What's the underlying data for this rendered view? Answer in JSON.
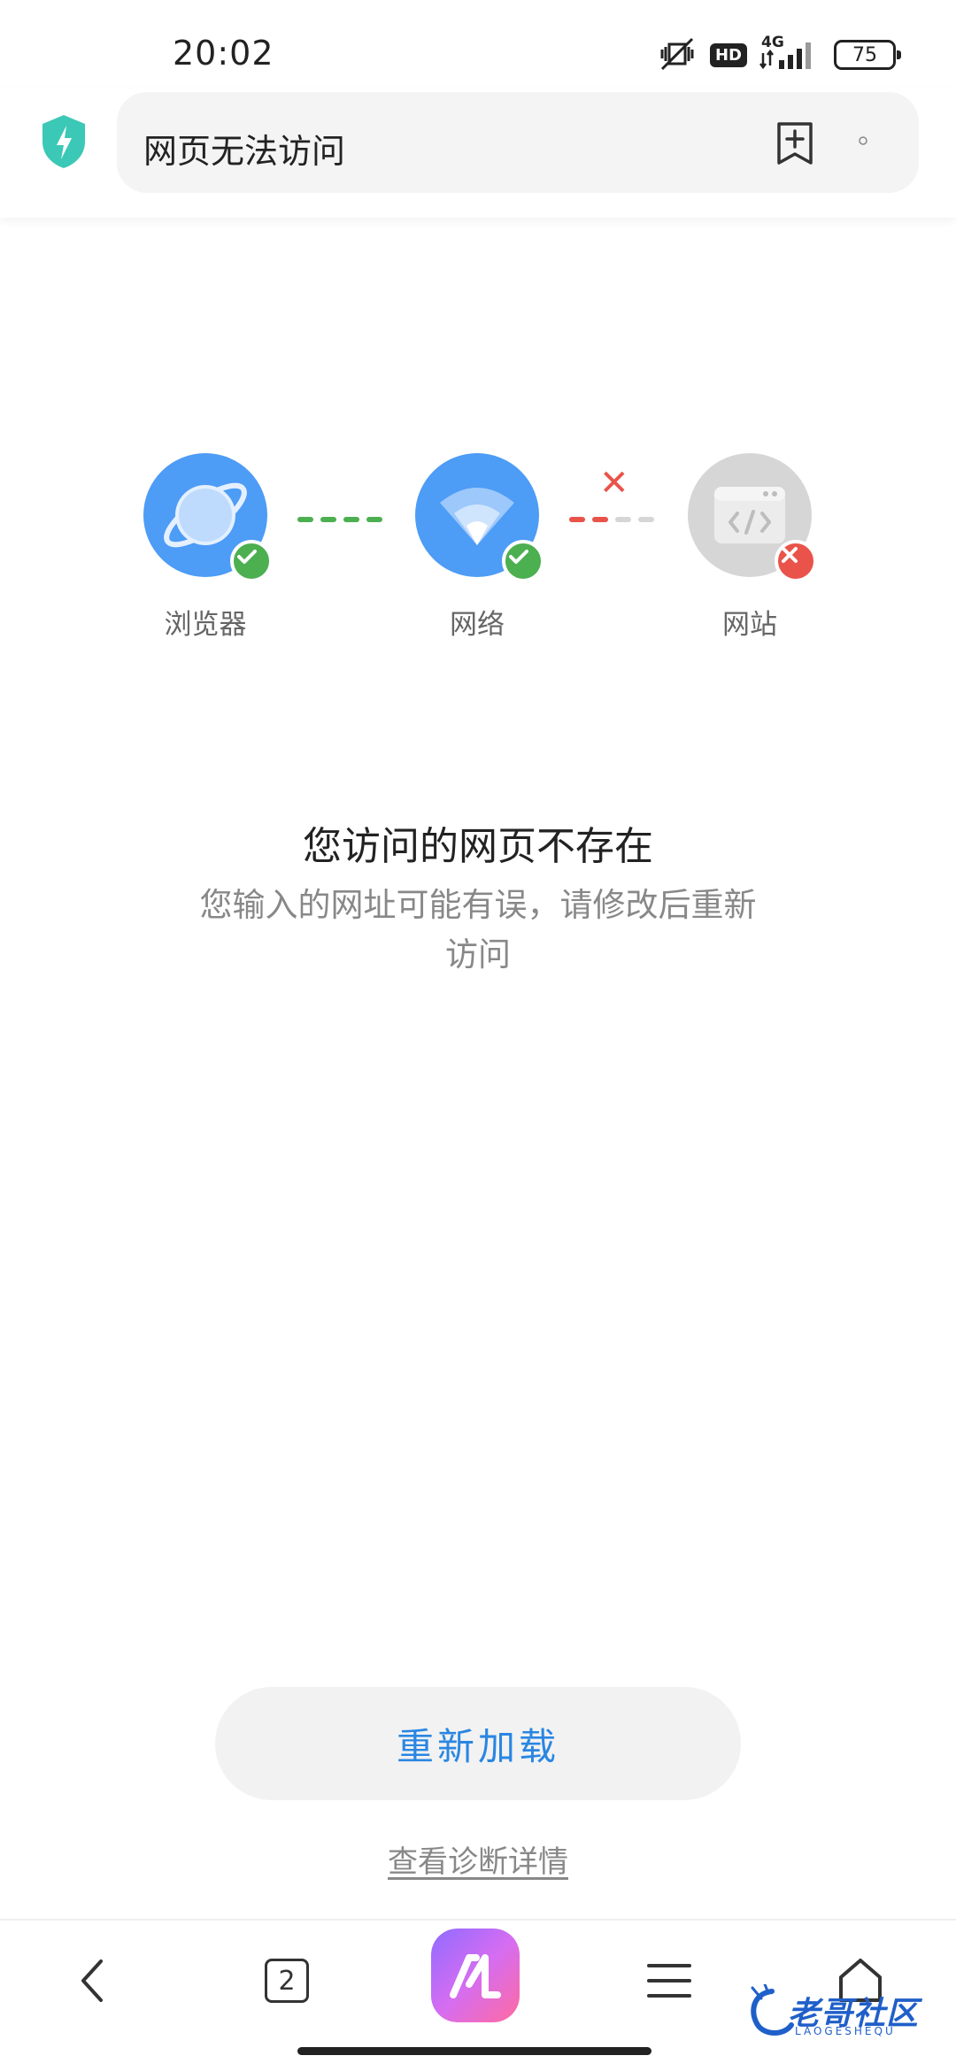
{
  "status_bar": {
    "time": "20:02",
    "hd": "HD",
    "network_type": "4G",
    "battery": "75"
  },
  "address_bar": {
    "title": "网页无法访问"
  },
  "diagnosis": {
    "nodes": [
      {
        "label": "浏览器",
        "status": "ok"
      },
      {
        "label": "网络",
        "status": "ok"
      },
      {
        "label": "网站",
        "status": "error"
      }
    ]
  },
  "message": {
    "title": "您访问的网页不存在",
    "description": "您输入的网址可能有误，请修改后重新访问"
  },
  "actions": {
    "reload": "重新加载",
    "details": "查看诊断详情"
  },
  "bottom_nav": {
    "tab_count": "2"
  },
  "watermark": {
    "text": "老哥社区",
    "sub": "LAOGESHEQU"
  },
  "colors": {
    "accent_blue": "#2a86e2",
    "ok_green": "#4caf50",
    "error_red": "#e9534a",
    "node_blue": "#4d9cf6"
  }
}
